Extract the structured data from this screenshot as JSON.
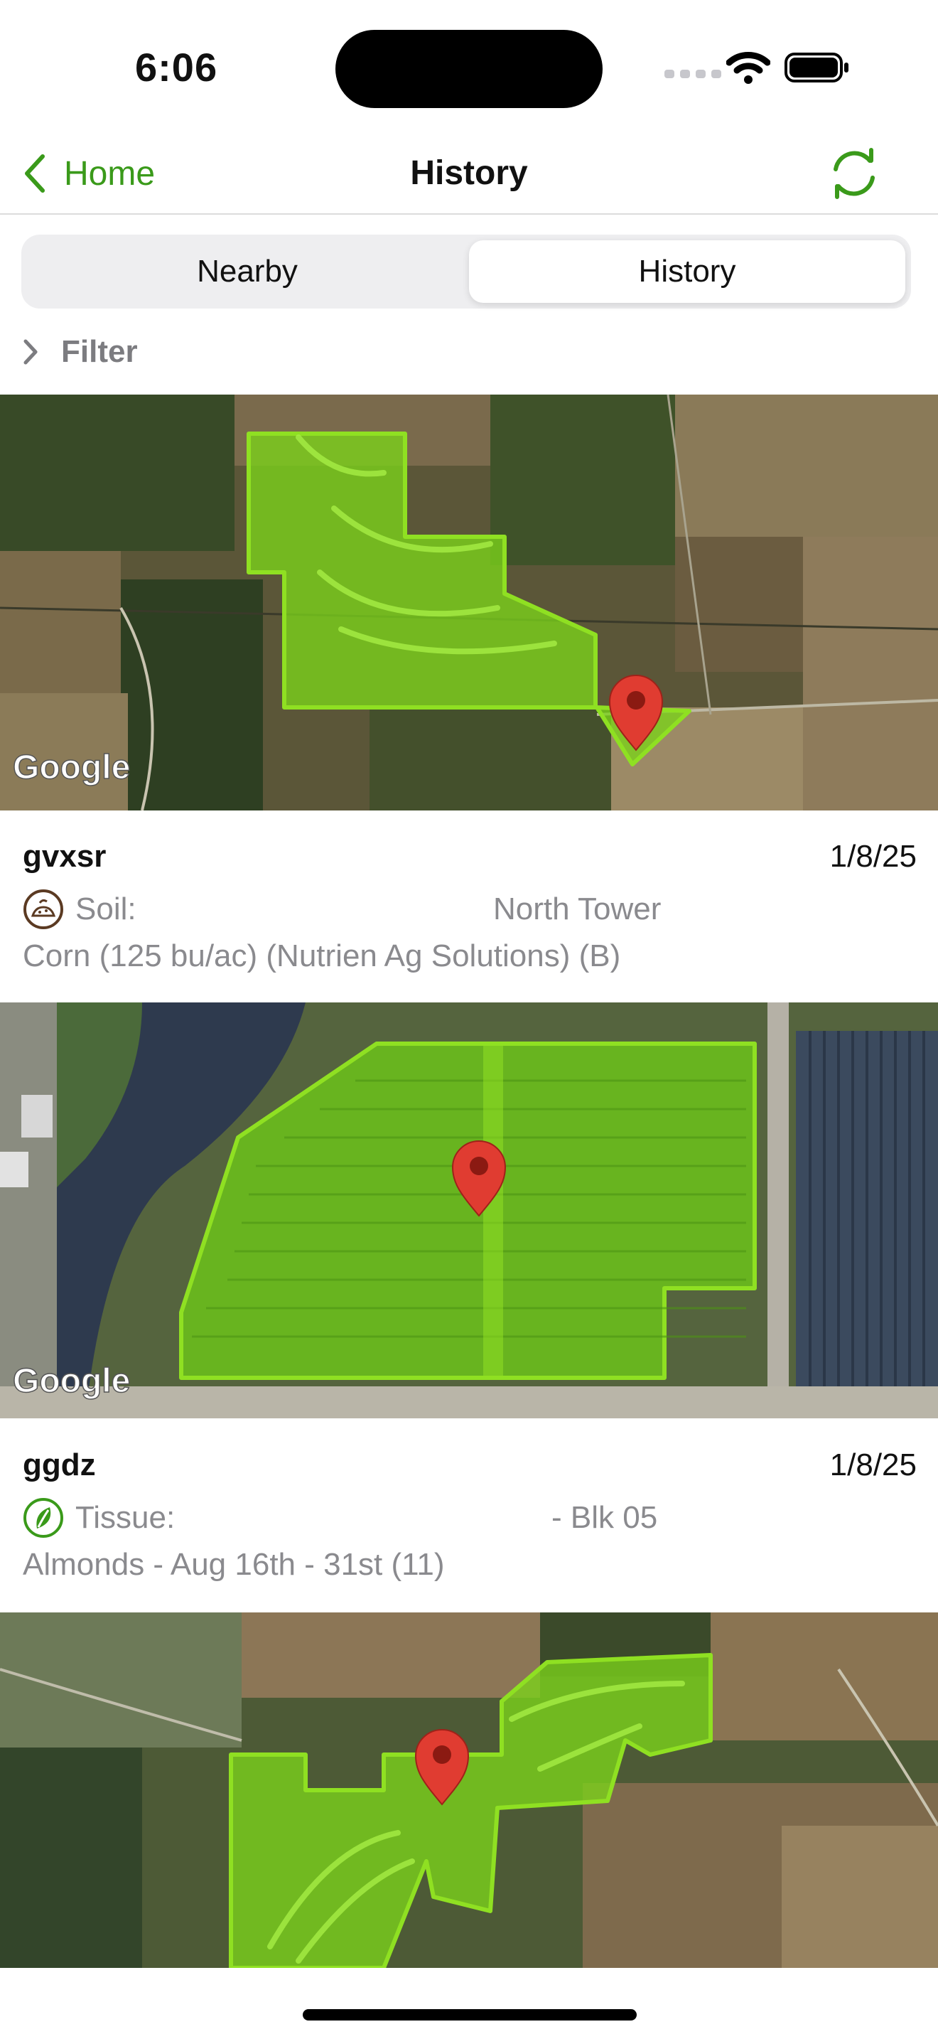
{
  "status_bar": {
    "time": "6:06"
  },
  "nav": {
    "back_label": "Home",
    "title": "History"
  },
  "segments": {
    "nearby": "Nearby",
    "history": "History",
    "selected": "History"
  },
  "filter": {
    "label": "Filter"
  },
  "map_attribution": "Google",
  "cards": [
    {
      "name": "gvxsr",
      "date": "1/8/25",
      "type_label": "Soil:",
      "location": "North Tower",
      "description": "Corn (125 bu/ac) (Nutrien Ag Solutions)  (B)",
      "icon": "soil-icon"
    },
    {
      "name": "ggdz",
      "date": "1/8/25",
      "type_label": "Tissue:",
      "location": "- Blk 05",
      "description": "Almonds - Aug 16th - 31st (11)",
      "icon": "tissue-leaf-icon"
    },
    {
      "icon": "map-pin-icon"
    }
  ],
  "colors": {
    "accent": "#3a9a1a",
    "field_fill": "#7bd31a",
    "pin": "#e03c31",
    "secondary_text": "#8a8a8e"
  }
}
